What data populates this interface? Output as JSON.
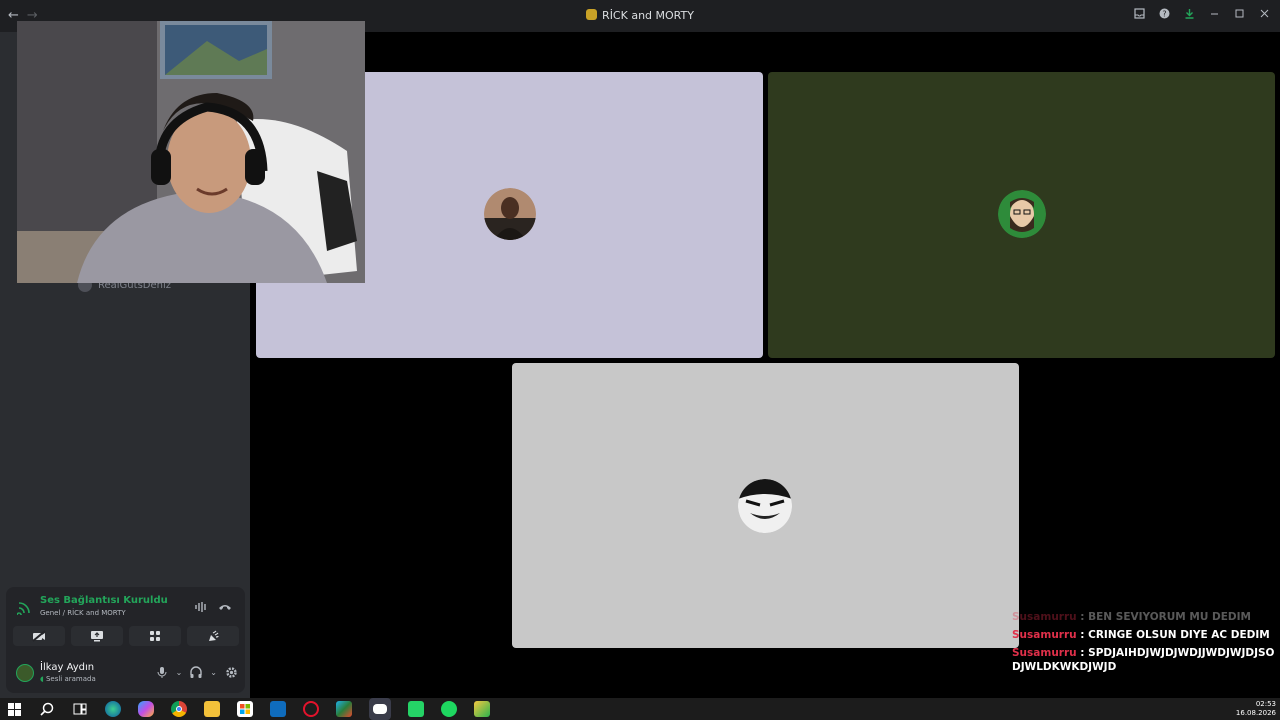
{
  "window": {
    "title": "RİCK and MORTY",
    "back_icon": "←",
    "forward_icon": "→",
    "controls": [
      "inbox-icon",
      "help-icon",
      "download-icon",
      "minimize-icon",
      "maximize-icon",
      "close-icon"
    ]
  },
  "sidebar": {
    "member_name": "RealGutsDeniz"
  },
  "voice": {
    "status": "Ses Bağlantısı Kuruldu",
    "channel": "Genel / RİCK and MORTY"
  },
  "user": {
    "name": "İlkay Aydın",
    "status": "Sesli aramada"
  },
  "chat": [
    {
      "name": "Susamurru",
      "text": " : BEN SEVIYORUM MU DEDIM",
      "faded": true
    },
    {
      "name": "Susamurru",
      "text": " : CRINGE OLSUN DIYE AC DEDIM",
      "faded": false
    },
    {
      "name": "Susamurru",
      "text": " : SPDJAIHDJWJDJWDJJWDJWJDJSODJWLDKWKDJWJD",
      "faded": false
    }
  ],
  "taskbar": {
    "time": "02:53",
    "date": "16.08.2026",
    "apps": [
      "windows-start-icon",
      "search-icon",
      "task-view-icon",
      "edge-icon",
      "copilot-icon",
      "chrome-icon",
      "file-explorer-icon",
      "store-icon",
      "mail-icon",
      "opera-icon",
      "m365-icon",
      "discord-icon",
      "whatsapp-icon",
      "spotify-icon",
      "paint-icon"
    ]
  },
  "colors": {
    "accent_green": "#23a55a",
    "chat_name": "#e0304a",
    "tile1_bg": "#c5c2d8",
    "tile2_bg": "#2f3a1e",
    "tile3_bg": "#c8c8c8"
  }
}
